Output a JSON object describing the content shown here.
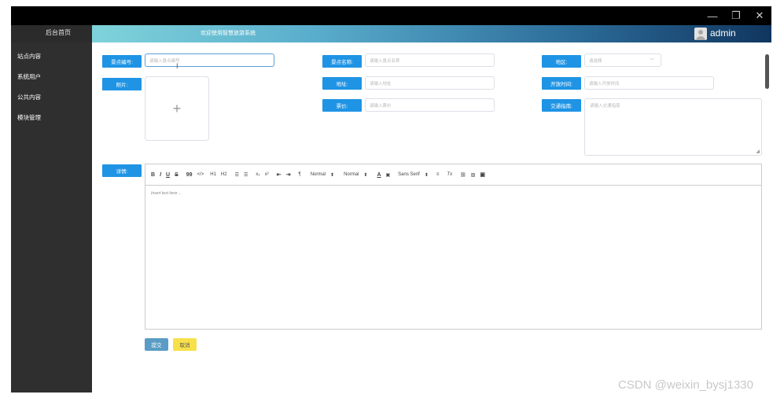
{
  "header": {
    "home_label": "后台首页",
    "welcome": "欢迎使用智慧旅游系统",
    "user": "admin"
  },
  "window_controls": {
    "minimize": "—",
    "restore": "❐",
    "close": "✕"
  },
  "sidebar": {
    "items": [
      {
        "label": "站点内容"
      },
      {
        "label": "系统用户"
      },
      {
        "label": "公共内容"
      },
      {
        "label": "模块管理"
      }
    ]
  },
  "form": {
    "id": {
      "label": "景点编号:",
      "placeholder": "请输入景点编号"
    },
    "name": {
      "label": "景点名称:",
      "placeholder": "请输入景点名称"
    },
    "region": {
      "label": "地区:",
      "placeholder": "请选择"
    },
    "photo": {
      "label": "照片:",
      "upload_icon": "+"
    },
    "address": {
      "label": "地址:",
      "placeholder": "请输入地址"
    },
    "open_time": {
      "label": "开放时间:",
      "placeholder": "请输入开放时间"
    },
    "price": {
      "label": "票价:",
      "placeholder": "请输入票价"
    },
    "traffic": {
      "label": "交通指南:",
      "placeholder": "请输入交通指南"
    },
    "details": {
      "label": "详情:",
      "placeholder": "Insert text here ..."
    }
  },
  "editor_toolbar": {
    "bold": "B",
    "italic": "I",
    "underline": "U",
    "strike": "S",
    "quote": "99",
    "code": "</>",
    "h1": "H1",
    "h2": "H2",
    "ol": "☰",
    "ul": "☰",
    "sub": "x₂",
    "sup": "x²",
    "indent_left": "⇤",
    "indent_right": "⇥",
    "rtl": "¶",
    "size": "Normal",
    "header": "Normal",
    "color": "A",
    "bg": "▣",
    "font": "Sans Serif",
    "align": "≡",
    "clean": "Tx",
    "link": "🔗",
    "image": "▨",
    "video": "▣"
  },
  "buttons": {
    "submit": "提交",
    "cancel": "取消"
  },
  "watermark": "CSDN @weixin_bysj1330"
}
